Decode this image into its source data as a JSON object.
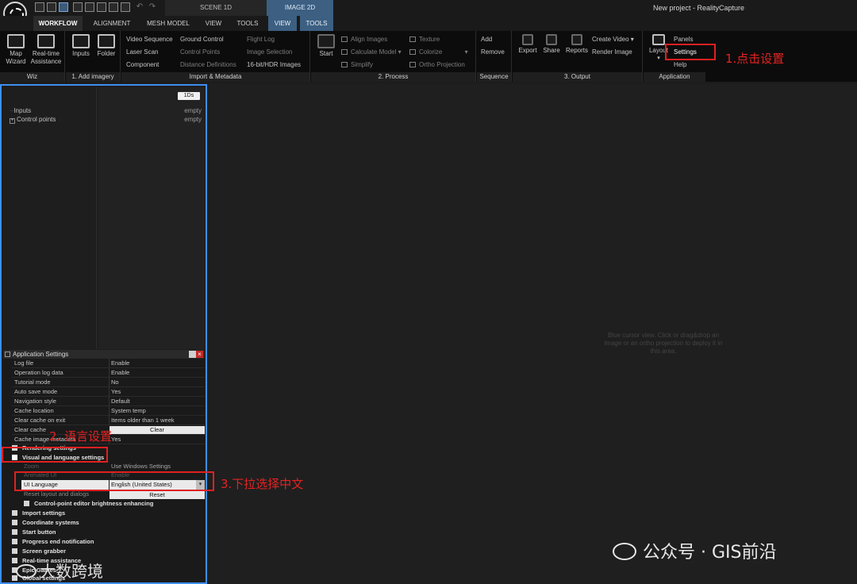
{
  "window": {
    "title": "New project - RealityCapture",
    "context_tabs": [
      "SCENE 1D",
      "IMAGE 2D"
    ]
  },
  "menu_tabs": [
    "WORKFLOW",
    "ALIGNMENT",
    "MESH MODEL",
    "VIEW",
    "TOOLS",
    "VIEW",
    "TOOLS"
  ],
  "ribbon": {
    "wiz": {
      "buttons": [
        "Map Wizard",
        "Real-time Assistance"
      ],
      "label": "Wiz"
    },
    "add_imagery": {
      "buttons": [
        "Inputs",
        "Folder"
      ],
      "label": "1. Add imagery"
    },
    "import_metadata": {
      "col1": [
        "Video Sequence",
        "Laser Scan",
        "Component"
      ],
      "col2": [
        "Ground Control",
        "Control Points",
        "Distance Definitions"
      ],
      "col3": [
        "Flight Log",
        "Image Selection",
        "16-bit/HDR Images"
      ],
      "label": "Import & Metadata"
    },
    "process": {
      "start": "Start",
      "col1": [
        "Align Images",
        "Calculate Model",
        "Simplify"
      ],
      "col2": [
        "Texture",
        "Colorize",
        "Ortho Projection"
      ],
      "label": "2. Process"
    },
    "sequence": {
      "buttons": [
        "Add",
        "Remove"
      ],
      "label": "Sequence"
    },
    "output": {
      "buttons": [
        "Export",
        "Share",
        "Reports"
      ],
      "col": [
        "Create Video",
        "Render Image"
      ],
      "label": "3. Output"
    },
    "application": {
      "layout": "Layout",
      "items": [
        "Panels",
        "Settings",
        "Help"
      ],
      "label": "Application"
    }
  },
  "tree": {
    "items": [
      "Inputs",
      "Control points"
    ]
  },
  "info": {
    "badge": "1Ds",
    "values": [
      "empty",
      "empty"
    ]
  },
  "settings": {
    "title": "Application Settings",
    "rows": [
      {
        "key": "Log file",
        "value": "Enable"
      },
      {
        "key": "Operation log data",
        "value": "Enable"
      },
      {
        "key": "Tutorial mode",
        "value": "No"
      },
      {
        "key": "Auto save mode",
        "value": "Yes"
      },
      {
        "key": "Navigation style",
        "value": "Default"
      },
      {
        "key": "Cache location",
        "value": "System temp"
      },
      {
        "key": "Clear cache on exit",
        "value": "Items older than 1 week"
      },
      {
        "key": "Clear cache",
        "button": "Clear"
      },
      {
        "key": "Cache image metadata",
        "value": "Yes"
      }
    ],
    "rendering_section": "Rendering settings",
    "visual_section": "Visual and language settings",
    "visual_rows": [
      {
        "key": "Zoom",
        "value": "Use Windows Settings"
      },
      {
        "key": "Animated UI",
        "value": "Enable"
      }
    ],
    "ui_language": {
      "key": "UI Language",
      "value": "English (United States)"
    },
    "reset_row": {
      "key": "Reset layout and dialogs",
      "button": "Reset"
    },
    "cp_section": "Control-point editor brightness enhancing",
    "sections": [
      "Import settings",
      "Coordinate systems",
      "Start button",
      "Progress end notification",
      "Screen grabber",
      "Real-time assistance",
      "Epic Games",
      "Global settings"
    ]
  },
  "viewport": {
    "hint": "Blue cursor view. Click or drag&drop an image or an ortho projection to deploy it in this area."
  },
  "annotations": {
    "step1": "1.点击设置",
    "step2": "2. 语言设置",
    "step3": "3.下拉选择中文",
    "watermark_right": "公众号 · GIS前沿",
    "watermark_left": "大数跨境"
  },
  "colors": {
    "accent_blue": "#3d8ff0",
    "annotation_red": "#e02020",
    "context_tab": "#3c5f82"
  }
}
